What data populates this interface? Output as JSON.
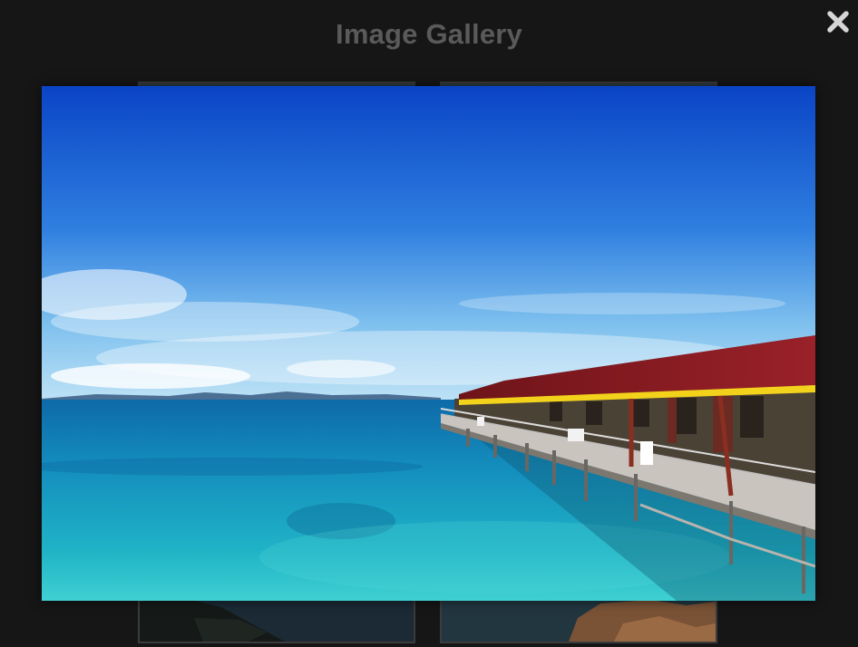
{
  "gallery": {
    "title": "Image Gallery",
    "close_icon": "close-icon",
    "thumbnails": [
      {
        "subject": "coastal-cliff-at-dusk"
      },
      {
        "subject": "rock-formation-at-sea"
      }
    ]
  },
  "lightbox": {
    "subject": "wooden-overwater-bungalows-on-turquoise-sea",
    "colors": {
      "sky_top": "#0a47c9",
      "sky_bottom": "#8ec8ef",
      "sea": "#1aa7c4",
      "roof": "#8a1a22",
      "trim": "#f2d21b"
    }
  }
}
